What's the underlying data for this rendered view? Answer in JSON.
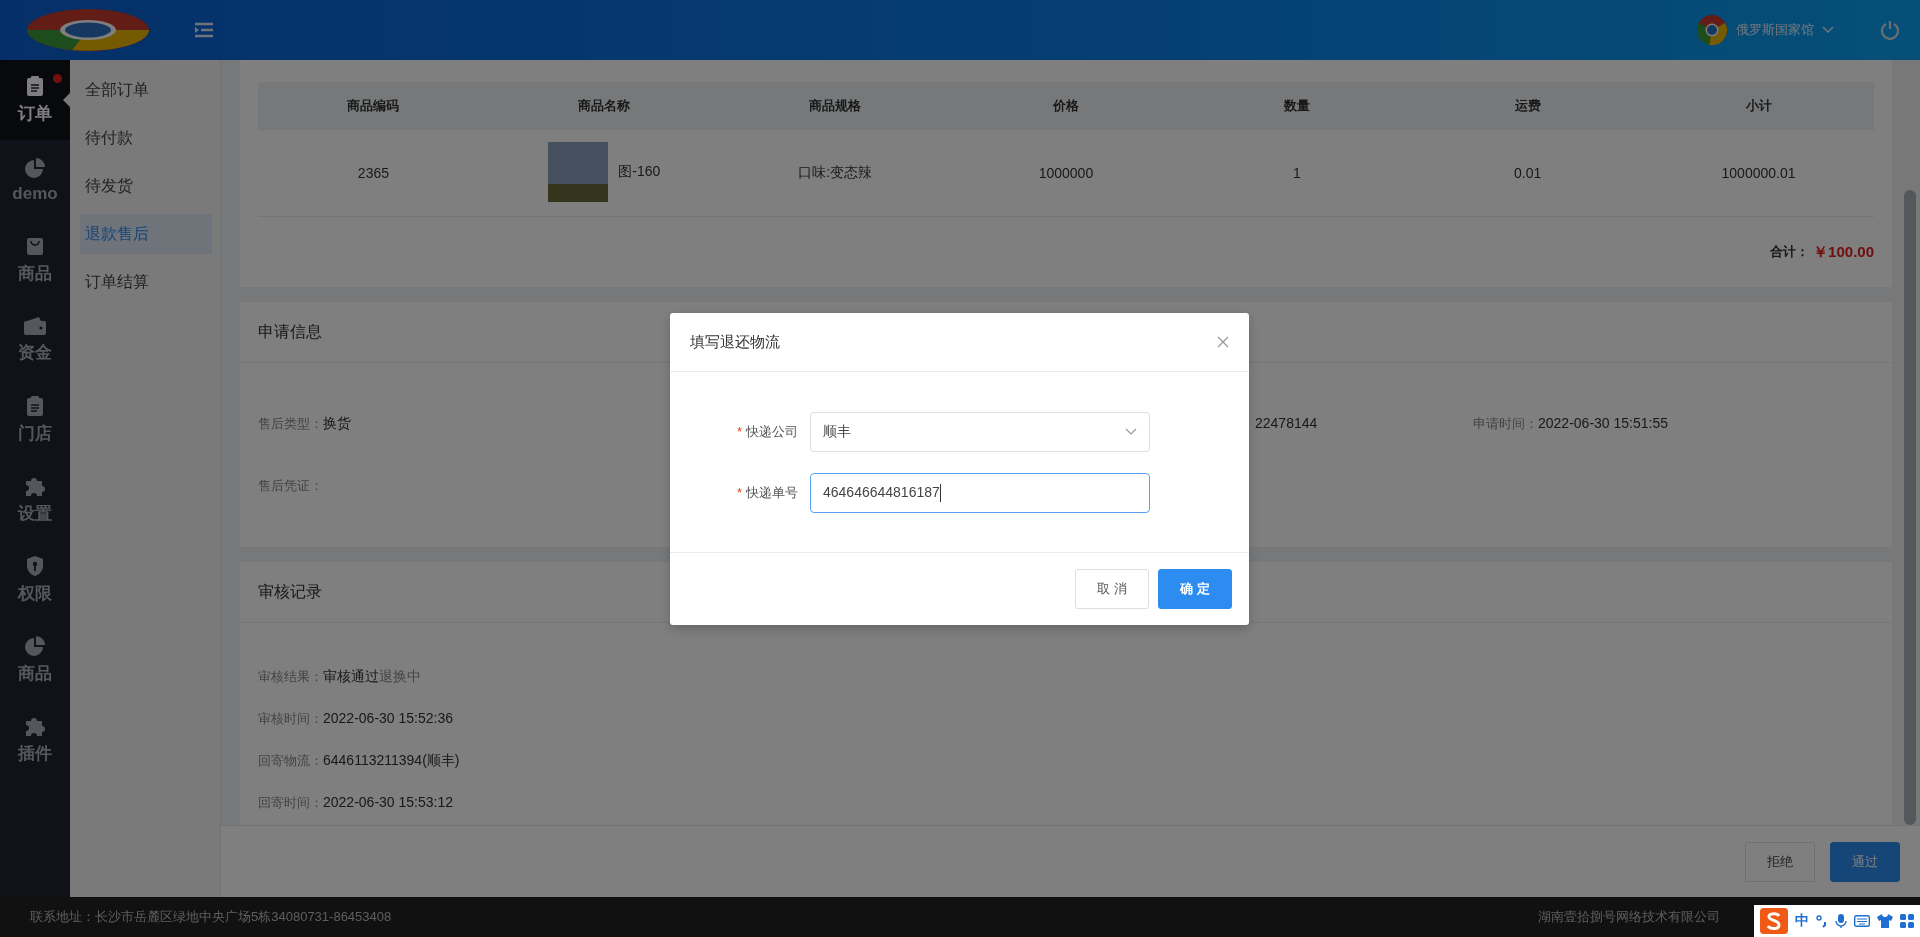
{
  "header": {
    "user": "俄罗斯国家馆"
  },
  "nav": [
    {
      "label": "订单",
      "selected": true,
      "badge": true
    },
    {
      "label": "demo",
      "selected": false,
      "badge": false
    },
    {
      "label": "商品",
      "selected": false,
      "badge": false
    },
    {
      "label": "资金",
      "selected": false,
      "badge": false
    },
    {
      "label": "门店",
      "selected": false,
      "badge": false
    },
    {
      "label": "设置",
      "selected": false,
      "badge": false
    },
    {
      "label": "权限",
      "selected": false,
      "badge": false
    },
    {
      "label": "商品",
      "selected": false,
      "badge": false
    },
    {
      "label": "插件",
      "selected": false,
      "badge": false
    }
  ],
  "subnav": [
    {
      "label": "全部订单",
      "selected": false
    },
    {
      "label": "待付款",
      "selected": false
    },
    {
      "label": "待发货",
      "selected": false
    },
    {
      "label": "退款售后",
      "selected": true
    },
    {
      "label": "订单结算",
      "selected": false
    }
  ],
  "products": {
    "columns": [
      "商品编码",
      "商品名称",
      "商品规格",
      "价格",
      "数量",
      "运费",
      "小计"
    ],
    "rows": [
      {
        "code": "2365",
        "name": "图-160",
        "spec": "口味:变态辣",
        "price": "1000000",
        "qty": "1",
        "shipping": "0.01",
        "subtotal": "1000000.01"
      }
    ],
    "total_label": "合计：",
    "total": "￥100.00"
  },
  "application": {
    "title": "申请信息",
    "fields": [
      {
        "label": "售后类型：",
        "value": "换货"
      },
      {
        "value": "22478144"
      },
      {
        "label": "申请时间：",
        "value": "2022-06-30 15:51:55"
      },
      {
        "label": "售后凭证："
      }
    ]
  },
  "review": {
    "title": "审核记录",
    "fields": [
      {
        "label": "审核结果：",
        "value": "审核通过",
        "note": "退换中"
      },
      {
        "label": "审核时间：",
        "value": "2022-06-30 15:52:36"
      },
      {
        "label": "回寄物流：",
        "value": "6446113211394(顺丰)"
      },
      {
        "label": "回寄时间：",
        "value": "2022-06-30 15:53:12"
      }
    ]
  },
  "actions": [
    {
      "label": "拒绝",
      "kind": "default"
    },
    {
      "label": "通过",
      "kind": "primary"
    }
  ],
  "footer": {
    "address": "联系地址：长沙市岳麓区绿地中央广场5栋34080731-86453408",
    "company": "湖南壹拾捌号网络技术有限公司"
  },
  "ime": {
    "mode": "中"
  },
  "dialog": {
    "title": "填写退还物流",
    "fields": [
      {
        "label": "快递公司",
        "required_mark": "*",
        "kind": "select",
        "value": "顺丰",
        "focused": false
      },
      {
        "label": "快递单号",
        "required_mark": "*",
        "kind": "input",
        "value": "464646644816187",
        "focused": true
      }
    ],
    "buttons": [
      {
        "label": "取 消",
        "kind": "default"
      },
      {
        "label": "确 定",
        "kind": "primary"
      }
    ]
  }
}
